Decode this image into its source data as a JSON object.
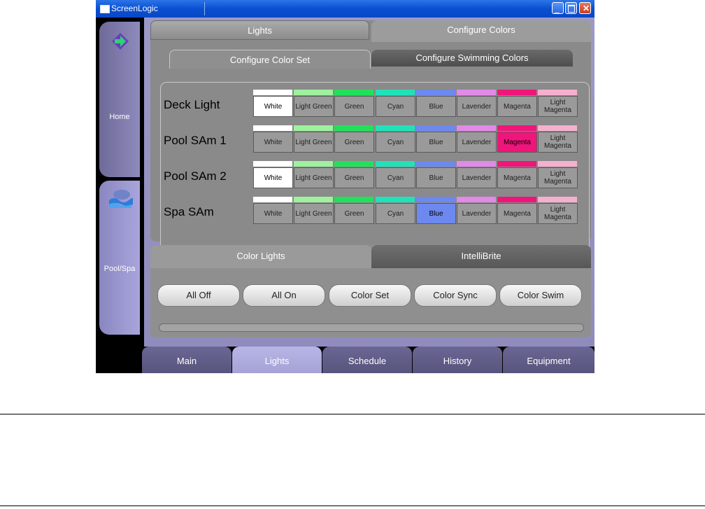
{
  "window": {
    "title": "ScreenLogic"
  },
  "sidebar": {
    "items": [
      {
        "label": "Home",
        "icon": "arrow-diamond-icon"
      },
      {
        "label": "Pool/Spa",
        "icon": "pool-wave-icon"
      }
    ]
  },
  "top_tabs": [
    "Lights",
    "Configure Colors"
  ],
  "inner_tabs": [
    "Configure Color Set",
    "Configure Swimming Colors"
  ],
  "colors": [
    {
      "label": "White",
      "hex": "#ffffff"
    },
    {
      "label": "Light Green",
      "hex": "#9ef29e"
    },
    {
      "label": "Green",
      "hex": "#1fe25a"
    },
    {
      "label": "Cyan",
      "hex": "#20e2b8"
    },
    {
      "label": "Blue",
      "hex": "#6d88ef"
    },
    {
      "label": "Lavender",
      "hex": "#e18ae8"
    },
    {
      "label": "Magenta",
      "hex": "#f0157a"
    },
    {
      "label": "Light Magenta",
      "hex": "#f6b0cf"
    }
  ],
  "lights": [
    {
      "name": "Deck Light",
      "selected": "White"
    },
    {
      "name": "Pool SAm 1",
      "selected": "Magenta"
    },
    {
      "name": "Pool SAm 2",
      "selected": "White"
    },
    {
      "name": "Spa SAm",
      "selected": "Blue"
    }
  ],
  "bottom_tabs": [
    "Color Lights",
    "IntelliBrite"
  ],
  "actions": [
    "All Off",
    "All On",
    "Color Set",
    "Color Sync",
    "Color Swim"
  ],
  "nav": {
    "items": [
      "Main",
      "Lights",
      "Schedule",
      "History",
      "Equipment"
    ],
    "active": "Lights"
  }
}
